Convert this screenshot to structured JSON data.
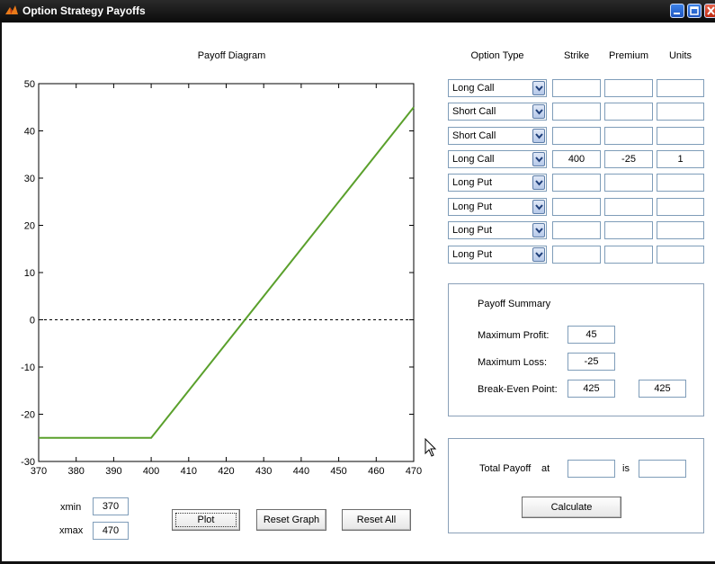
{
  "window": {
    "title": "Option Strategy Payoffs"
  },
  "chart_data": {
    "type": "line",
    "title": "Payoff Diagram",
    "xlabel": "",
    "ylabel": "",
    "xlim": [
      370,
      470
    ],
    "ylim": [
      -30,
      50
    ],
    "xticks": [
      370,
      380,
      390,
      400,
      410,
      420,
      430,
      440,
      450,
      460,
      470
    ],
    "yticks": [
      -30,
      -20,
      -10,
      0,
      10,
      20,
      30,
      40,
      50
    ],
    "grid": false,
    "zero_line": {
      "y": 0,
      "style": "dashed"
    },
    "series": [
      {
        "color": "#5aa02c",
        "x": [
          370,
          400,
          470
        ],
        "y": [
          -25,
          -25,
          45
        ]
      }
    ]
  },
  "table": {
    "headers": {
      "option_type": "Option Type",
      "strike": "Strike",
      "premium": "Premium",
      "units": "Units"
    },
    "rows": [
      {
        "type": "Long Call",
        "strike": "",
        "premium": "",
        "units": ""
      },
      {
        "type": "Short Call",
        "strike": "",
        "premium": "",
        "units": ""
      },
      {
        "type": "Short Call",
        "strike": "",
        "premium": "",
        "units": ""
      },
      {
        "type": "Long Call",
        "strike": "400",
        "premium": "-25",
        "units": "1"
      },
      {
        "type": "Long Put",
        "strike": "",
        "premium": "",
        "units": ""
      },
      {
        "type": "Long Put",
        "strike": "",
        "premium": "",
        "units": ""
      },
      {
        "type": "Long Put",
        "strike": "",
        "premium": "",
        "units": ""
      },
      {
        "type": "Long Put",
        "strike": "",
        "premium": "",
        "units": ""
      }
    ]
  },
  "summary": {
    "title": "Payoff Summary",
    "max_profit_label": "Maximum Profit:",
    "max_profit": "45",
    "max_loss_label": "Maximum Loss:",
    "max_loss": "-25",
    "breakeven_label": "Break-Even Point:",
    "breakeven_1": "425",
    "breakeven_2": "425"
  },
  "total": {
    "label": "Total Payoff",
    "at_label": "at",
    "is_label": "is",
    "at_value": "",
    "is_value": "",
    "calculate_label": "Calculate"
  },
  "range": {
    "xmin_label": "xmin",
    "xmin": "370",
    "xmax_label": "xmax",
    "xmax": "470"
  },
  "buttons": {
    "plot": "Plot",
    "reset_graph": "Reset Graph",
    "reset_all": "Reset All"
  },
  "icons": {
    "app": "matlab-logo-icon",
    "minimize": "minimize-icon",
    "maximize": "maximize-icon",
    "close": "close-icon",
    "cursor": "mouse-pointer-icon"
  }
}
